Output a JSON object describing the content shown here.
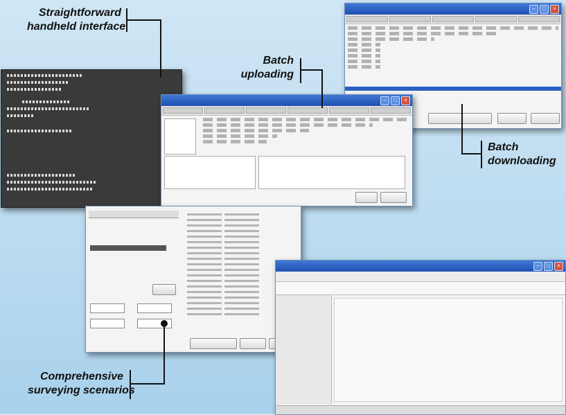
{
  "callouts": {
    "handheld": [
      "Straightforward",
      "handheld interface"
    ],
    "batch_upload": [
      "Batch",
      "uploading"
    ],
    "batch_download": [
      "Batch",
      "downloading"
    ],
    "surveying": [
      "Comprehensive",
      "surveying scenarios"
    ]
  },
  "colors": {
    "background": "#bcdcf0",
    "titlebar": "#2a60c4",
    "terminal": "#3a3a3a",
    "callout_text": "#111111"
  }
}
